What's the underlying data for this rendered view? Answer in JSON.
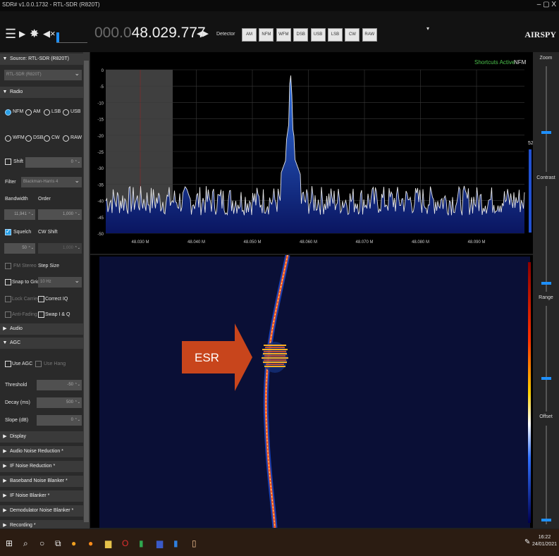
{
  "window": {
    "title": "SDR# v1.0.0.1732 - RTL-SDR (R820T)",
    "controls": "– ▢ X"
  },
  "toolbar": {
    "freq_dim": "000.0",
    "freq_main": "48.029.777",
    "detector_label": "Detector",
    "modes": [
      "AM",
      "NFM",
      "WFM",
      "DSB",
      "USB",
      "LSB",
      "CW",
      "RAW"
    ],
    "logo": "AIRSPY"
  },
  "source": {
    "section": "Source: RTL-SDR (R820T)",
    "device": "RTL-SDR (R820T)"
  },
  "radio": {
    "section": "Radio",
    "modes_row1": [
      "NFM",
      "AM",
      "LSB",
      "USB"
    ],
    "modes_row2": [
      "WFM",
      "DSB",
      "CW",
      "RAW"
    ],
    "selected_mode": "NFM",
    "shift_label": "Shift",
    "shift_value": "0",
    "filter_label": "Filter",
    "filter_value": "Blackman-Harris 4",
    "bandwidth_label": "Bandwidth",
    "order_label": "Order",
    "bandwidth_value": "11,941",
    "order_value": "1,000",
    "squelch_label": "Squelch",
    "cwshift_label": "CW Shift",
    "squelch_value": "50",
    "cwshift_value": "1,000",
    "fmstereo_label": "FM Stereo",
    "stepsize_label": "Step Size",
    "snap_label": "Snap to Grid",
    "step_value": "10 Hz",
    "lockcarrier_label": "Lock Carrier",
    "correctiq_label": "Correct IQ",
    "antifading_label": "Anti-Fading",
    "swapiq_label": "Swap I & Q"
  },
  "audio": {
    "section": "Audio"
  },
  "agc": {
    "section": "AGC",
    "use_agc": "Use AGC",
    "use_hang": "Use Hang",
    "threshold_label": "Threshold",
    "threshold_value": "-50",
    "decay_label": "Decay (ms)",
    "decay_value": "500",
    "slope_label": "Slope (dB)",
    "slope_value": "0"
  },
  "plugins": [
    "Display",
    "Audio Noise Reduction *",
    "IF Noise Reduction *",
    "Baseband Noise Blanker *",
    "IF Noise Blanker *",
    "Demodulator Noise Blanker *",
    "Recording *"
  ],
  "spectrum": {
    "status_active": "Shortcuts Active",
    "status_mode": "NFM",
    "db_ticks": [
      "0",
      "-5",
      "-10",
      "-15",
      "-20",
      "-25",
      "-30",
      "-35",
      "-40",
      "-45",
      "-50"
    ],
    "freq_ticks": [
      "48.030 M",
      "48.040 M",
      "48.050 M",
      "48.060 M",
      "48.070 M",
      "48.080 M",
      "48.090 M"
    ],
    "level_value": "52",
    "peak_freq_mhz": 48.0568,
    "noise_floor_db": -40,
    "peak_db": 0
  },
  "annotation": {
    "label": "ESR"
  },
  "right_panel": {
    "zoom": "Zoom",
    "contrast": "Contrast",
    "range": "Range",
    "offset": "Offset"
  },
  "taskbar": {
    "time": "16:22",
    "date": "24/01/2021"
  }
}
